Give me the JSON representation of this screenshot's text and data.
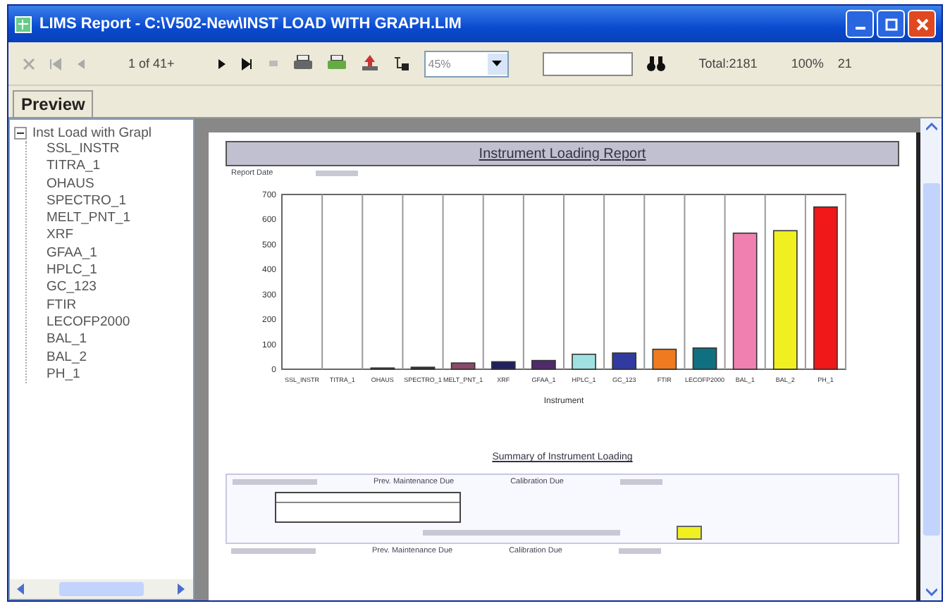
{
  "window": {
    "title": "LIMS Report - C:\\V502-New\\INST LOAD WITH GRAPH.LIM"
  },
  "toolbar": {
    "page_indicator": "1 of 41+",
    "zoom": "45%",
    "total": "Total:2181",
    "percent": "100%",
    "extra": "21"
  },
  "tabs": [
    {
      "label": "Preview",
      "selected": true
    }
  ],
  "tree": {
    "label": "Inst Load with Grapl",
    "expanded": true,
    "children": [
      {
        "label": "SSL_INSTR"
      },
      {
        "label": "TITRA_1"
      },
      {
        "label": "OHAUS"
      },
      {
        "label": "SPECTRO_1"
      },
      {
        "label": "MELT_PNT_1"
      },
      {
        "label": "XRF"
      },
      {
        "label": "GFAA_1"
      },
      {
        "label": "HPLC_1"
      },
      {
        "label": "GC_123"
      },
      {
        "label": "FTIR"
      },
      {
        "label": "LECOFP2000"
      },
      {
        "label": "BAL_1"
      },
      {
        "label": "BAL_2"
      },
      {
        "label": "PH_1"
      }
    ]
  },
  "report": {
    "title": "Instrument Loading Report",
    "date_label": "Report Date",
    "chart_data": {
      "type": "bar",
      "xlabel": "Instrument",
      "categories": [
        "SSL_INSTR",
        "TITRA_1",
        "OHAUS",
        "SPECTRO_1",
        "MELT_PNT_1",
        "XRF",
        "GFAA_1",
        "HPLC_1",
        "GC_123",
        "FTIR",
        "LECOFP2000",
        "BAL_1",
        "BAL_2",
        "PH_1"
      ],
      "series": [
        {
          "values": [
            0,
            0,
            5,
            8,
            25,
            30,
            35,
            60,
            65,
            80,
            85,
            545,
            555,
            650
          ],
          "colors": [
            "#ffffff",
            "#ffffff",
            "#404040",
            "#303030",
            "#8a4a6a",
            "#202060",
            "#502a6a",
            "#a0e0e0",
            "#303aa0",
            "#f07a20",
            "#107080",
            "#f080b0",
            "#f0f020",
            "#f01818"
          ]
        }
      ],
      "ylim": [
        0,
        700
      ],
      "yticks": [
        0,
        100,
        200,
        300,
        400,
        500,
        600,
        700
      ]
    },
    "summary_title": "Summary of Instrument Loading",
    "sections": [
      {
        "maint_label": "Prev. Maintenance Due",
        "calib_label": "Calibration Due"
      },
      {
        "maint_label": "Prev. Maintenance Due",
        "calib_label": "Calibration Due"
      }
    ]
  }
}
